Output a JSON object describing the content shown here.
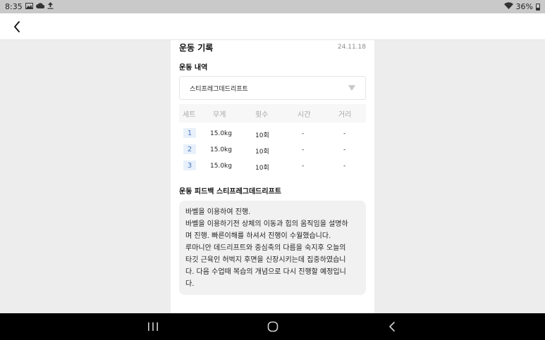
{
  "status_bar": {
    "time": "8:35",
    "left_icons": [
      "image-icon",
      "cloud-icon",
      "upload-icon"
    ],
    "battery_text": "36%"
  },
  "record": {
    "title": "운동 기록",
    "date": "24.11.18"
  },
  "history": {
    "section_title": "운동 내역",
    "selected_exercise": "스티프레그데드리프트",
    "columns": [
      "세트",
      "무게",
      "횟수",
      "시간",
      "거리"
    ],
    "rows": [
      {
        "set": "1",
        "weight": "15.0kg",
        "reps": "10회",
        "time": "-",
        "distance": "-"
      },
      {
        "set": "2",
        "weight": "15.0kg",
        "reps": "10회",
        "time": "-",
        "distance": "-"
      },
      {
        "set": "3",
        "weight": "15.0kg",
        "reps": "10회",
        "time": "-",
        "distance": "-"
      }
    ]
  },
  "feedback": {
    "section_title": "운동 피드백 스티프레그데드리프트",
    "lines": [
      "바벨을 이용하여 진행.",
      "바벨을 이용하기전 상체의 이동과 힙의 움직임을 설명하",
      "며 진행. 빠른이해를 하셔서 진행이 수월했습니다.",
      "루마니안 데드리프트와 중심축의 다름을 숙지후 오늘의",
      "타깃 근육인 허벅지 후면을 신장시키는데 집중하였습니",
      "다. 다음 수업때 복습의 개념으로 다시 진행할 예정입니",
      "다."
    ]
  },
  "colors": {
    "status_bar_bg": "#c9c9c9",
    "set_badge_bg": "#e8f0fb",
    "set_badge_text": "#4a79c2",
    "feedback_bg": "#f1f1f1",
    "nav_bar_bg": "#000000"
  }
}
